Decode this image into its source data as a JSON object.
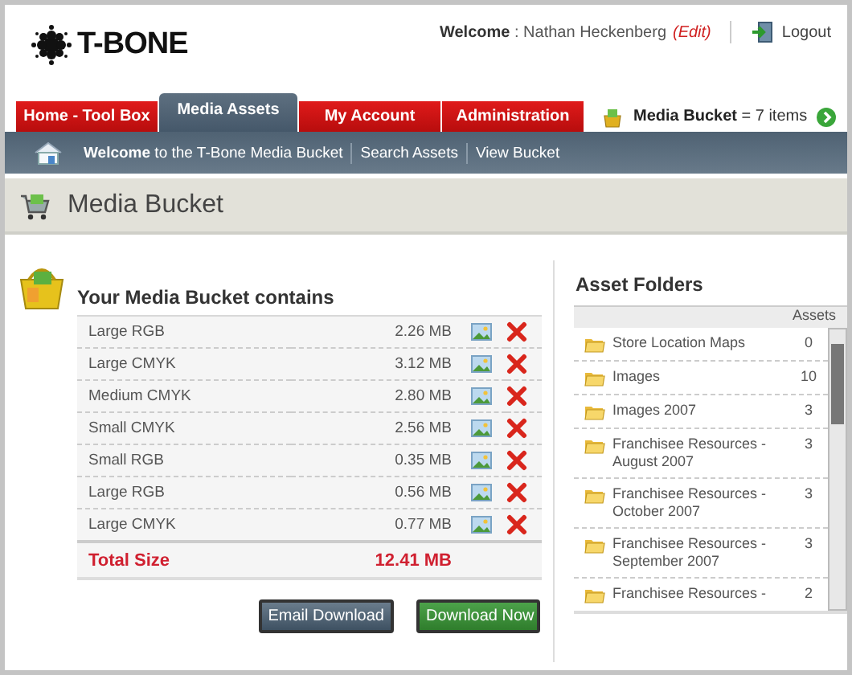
{
  "logo": {
    "text": "T-BONE"
  },
  "user": {
    "welcome": "**Welcome** : Nathan Heckenberg",
    "edit": "(Edit)",
    "logout": "Logout"
  },
  "tabs": [
    {
      "label": "Home - Tool Box",
      "selected": false
    },
    {
      "label": "Media Assets",
      "selected": true
    },
    {
      "label": "My Account",
      "selected": false
    },
    {
      "label": "Administration",
      "selected": false
    }
  ],
  "bucket_status": "**Media Bucket** = 7 items",
  "subnav": [
    "**Welcome** to the T-Bone Media Bucket",
    "Search Assets",
    "View Bucket"
  ],
  "page_title": "Media Bucket",
  "bucket": {
    "title": "Your Media Bucket contains",
    "items": [
      {
        "name": "Large RGB",
        "size": "2.26 MB"
      },
      {
        "name": "Large CMYK",
        "size": "3.12 MB"
      },
      {
        "name": "Medium CMYK",
        "size": "2.80 MB"
      },
      {
        "name": "Small CMYK",
        "size": "2.56 MB"
      },
      {
        "name": "Small RGB",
        "size": "0.35 MB"
      },
      {
        "name": "Large RGB",
        "size": "0.56 MB"
      },
      {
        "name": "Large CMYK",
        "size": "0.77 MB"
      }
    ],
    "total_label": "Total Size",
    "total": "12.41 MB",
    "buttons": [
      {
        "label": "Email Download",
        "kind": "secondary"
      },
      {
        "label": "Download Now",
        "kind": "primary"
      }
    ]
  },
  "folders": {
    "title": "Asset Folders",
    "column": "Assets",
    "items": [
      {
        "name": "Store Location Maps",
        "count": "0"
      },
      {
        "name": "Images",
        "count": "10"
      },
      {
        "name": "Images 2007",
        "count": "3"
      },
      {
        "name": "Franchisee Resources - August 2007",
        "count": "3"
      },
      {
        "name": "Franchisee Resources - October 2007",
        "count": "3"
      },
      {
        "name": "Franchisee Resources - September 2007",
        "count": "3"
      },
      {
        "name": "Franchisee Resources -",
        "count": "2"
      }
    ]
  }
}
